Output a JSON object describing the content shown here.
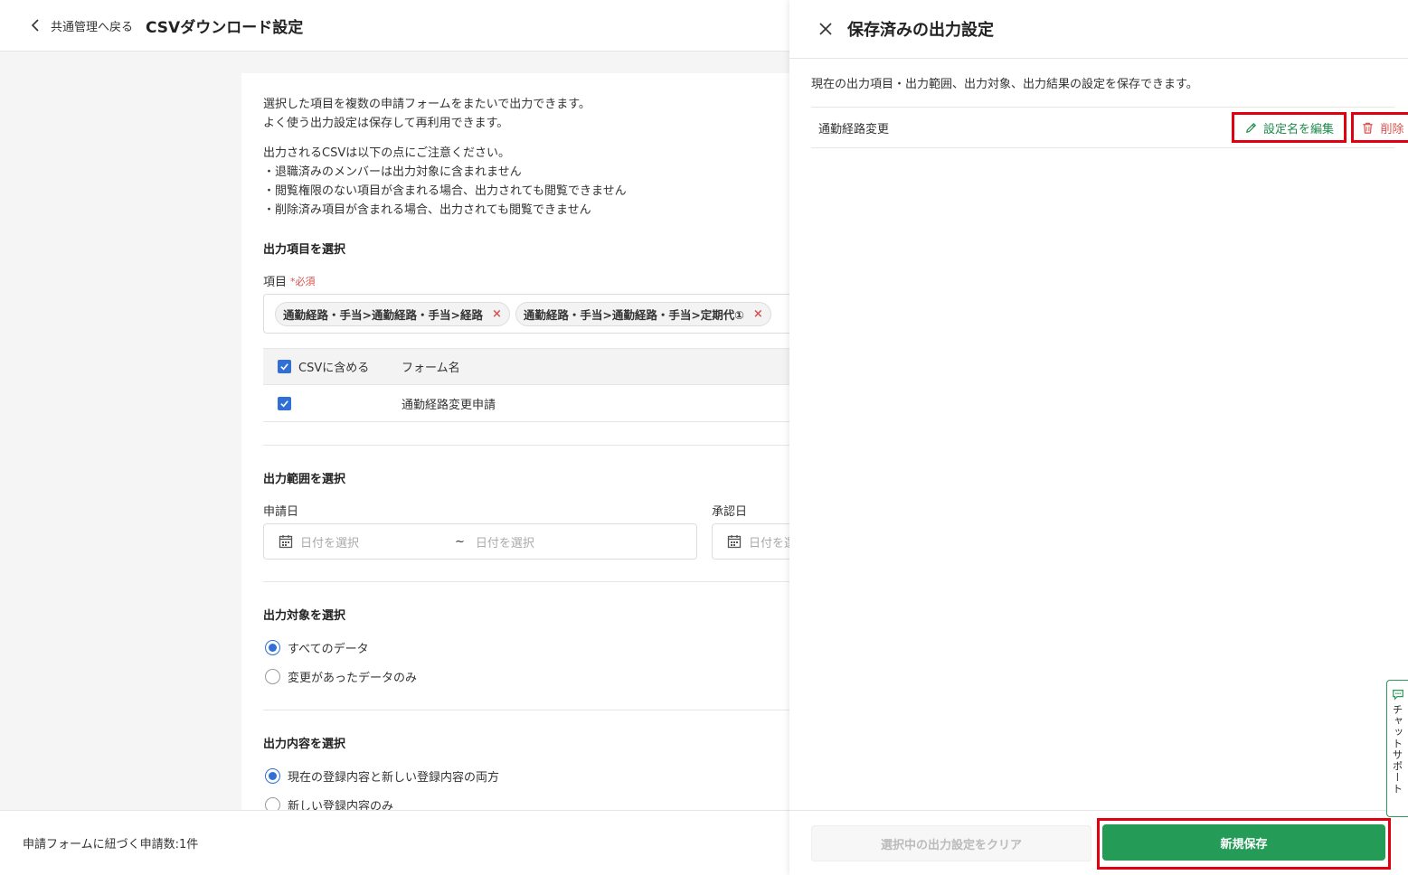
{
  "header": {
    "back_label": "共通管理へ戻る",
    "title": "CSVダウンロード設定"
  },
  "intro": {
    "line1": "選択した項目を複数の申請フォームをまたいで出力できます。",
    "line2": "よく使う出力設定は保存して再利用できます。",
    "note_title": "出力されるCSVは以下の点にご注意ください。",
    "note1": "・退職済みのメンバーは出力対象に含まれません",
    "note2": "・閲覧権限のない項目が含まれる場合、出力されても閲覧できません",
    "note3": "・削除済み項目が含まれる場合、出力されても閲覧できません"
  },
  "items_section": {
    "title": "出力項目を選択",
    "label": "項目",
    "required": "*必須",
    "chips": [
      "通勤経路・手当>通勤経路・手当>経路",
      "通勤経路・手当>通勤経路・手当>定期代①"
    ],
    "chip_remove": "×",
    "table": {
      "col_csv": "CSVに含める",
      "col_form": "フォーム名",
      "rows": [
        {
          "form": "通勤経路変更申請"
        }
      ]
    }
  },
  "range_section": {
    "title": "出力範囲を選択",
    "apply_label": "申請日",
    "approve_label": "承認日",
    "date_placeholder": "日付を選択",
    "date_placeholder_cut": "日付を選",
    "tilde": "~"
  },
  "target_section": {
    "title": "出力対象を選択",
    "opt_all": "すべてのデータ",
    "opt_changed": "変更があったデータのみ"
  },
  "content_section": {
    "title": "出力内容を選択",
    "opt_both": "現在の登録内容と新しい登録内容の両方",
    "opt_new": "新しい登録内容のみ"
  },
  "bottom_bar": {
    "count_text": "申請フォームに紐づく申請数:1件"
  },
  "panel": {
    "title": "保存済みの出力設定",
    "description": "現在の出力項目・出力範囲、出力対象、出力結果の設定を保存できます。",
    "saved_items": [
      {
        "name": "通勤経路変更"
      }
    ],
    "edit_label": "設定名を編集",
    "delete_label": "削除",
    "clear_label": "選択中の出力設定をクリア",
    "save_label": "新規保存"
  },
  "chat_support": {
    "label": "チャットサポート"
  },
  "colors": {
    "accent_blue": "#2f6fd6",
    "primary_green": "#259b58",
    "danger_red": "#d9534f",
    "highlight_red": "#e0000f"
  }
}
